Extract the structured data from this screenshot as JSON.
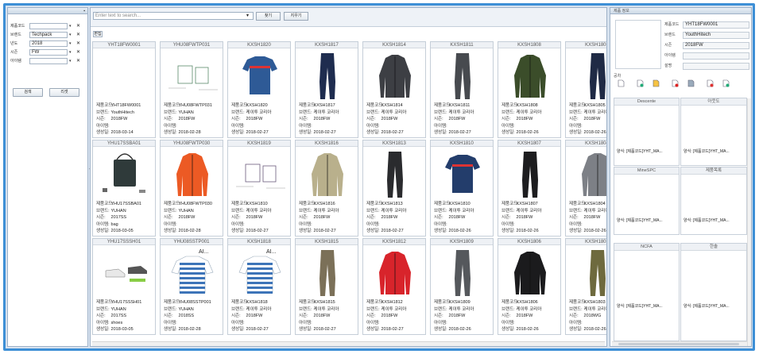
{
  "filters": [
    {
      "label": "제품코드",
      "value": ""
    },
    {
      "label": "브랜드",
      "value": "Techpack"
    },
    {
      "label": "년도",
      "value": "2018"
    },
    {
      "label": "시즌",
      "value": "FW"
    },
    {
      "label": "아이템",
      "value": ""
    }
  ],
  "left_buttons": {
    "search": "검색",
    "reset": "리셋"
  },
  "search": {
    "placeholder": "Enter text to search...",
    "find_label": "찾기",
    "clear_label": "지우기"
  },
  "grid_toggle_label": "편집",
  "labels": {
    "code": "제품코드:",
    "brand": "브랜드:",
    "season": "시즌:",
    "item": "아이템:",
    "created": "생성일:"
  },
  "cards": [
    {
      "code": "YHT18FW0001",
      "img": "blank",
      "color": "#fff",
      "v_code": "YHT18FW0001",
      "brand": "YouthHitech",
      "season": "2018FW",
      "item": "",
      "created": "2018-03-14"
    },
    {
      "code": "YHU08FWTP031",
      "img": "sketch",
      "color": "#5a8a6a",
      "v_code": "YHU08FWTP031",
      "brand": "YUHAN",
      "season": "2018FW",
      "item": "",
      "created": "2018-02-28"
    },
    {
      "code": "KXSH1820",
      "img": "shirt",
      "color": "#2e5a96",
      "v_code": "KXSH1820",
      "brand": "케이투 코리아",
      "season": "2018FW",
      "item": "",
      "created": "2018-02-27"
    },
    {
      "code": "KXSH1817",
      "img": "pants",
      "color": "#1e2c4f",
      "v_code": "KXSH1817",
      "brand": "케이투 코리아",
      "season": "2018FW",
      "item": "",
      "created": "2018-02-27"
    },
    {
      "code": "KXSH1814",
      "img": "jacket",
      "color": "#3d3f44",
      "v_code": "KXSH1814",
      "brand": "케이투 코리아",
      "season": "2018FW",
      "item": "",
      "created": "2018-02-27"
    },
    {
      "code": "KXSH1811",
      "img": "pants",
      "color": "#474a4f",
      "v_code": "KXSH1811",
      "brand": "케이투 코리아",
      "season": "2018FW",
      "item": "",
      "created": "2018-02-27"
    },
    {
      "code": "KXSH1808",
      "img": "jacket",
      "color": "#3b4d2a",
      "v_code": "KXSH1808",
      "brand": "케이투 코리아",
      "season": "2018FW",
      "item": "",
      "created": "2018-02-26"
    },
    {
      "code": "KXSH1805",
      "img": "pants",
      "color": "#1f2a45",
      "v_code": "KXSH1805",
      "brand": "케이투 코리아",
      "season": "2018FW",
      "item": "",
      "created": "2018-02-26"
    },
    {
      "code": "YHU17SSBA01",
      "img": "bag",
      "color": "#2f3a3a",
      "v_code": "YHU17SSBA01",
      "brand": "YUHAN",
      "season": "2017SS",
      "item": "bag",
      "created": "2018-03-05"
    },
    {
      "code": "YHU08FWTP030",
      "img": "jacket",
      "color": "#ec5a24",
      "v_code": "YHU08FWTP030",
      "brand": "YUHAN",
      "season": "2018FW",
      "item": "",
      "created": "2018-02-28"
    },
    {
      "code": "KXSH1819",
      "img": "sketch",
      "color": "#6a5a7a",
      "v_code": "KXSH1810",
      "brand": "케이투 코리아",
      "season": "2018FW",
      "item": "",
      "created": "2018-02-27"
    },
    {
      "code": "KXSH1816",
      "img": "jacket",
      "color": "#b9b08c",
      "v_code": "KXSH1816",
      "brand": "케이투 코리아",
      "season": "2018FW",
      "item": "",
      "created": "2018-02-27"
    },
    {
      "code": "KXSH1813",
      "img": "pants",
      "color": "#2a2b2e",
      "v_code": "KXSH1813",
      "brand": "케이투 코리아",
      "season": "2018FW",
      "item": "",
      "created": "2018-02-27"
    },
    {
      "code": "KXSH1810",
      "img": "shirt",
      "color": "#233d6b",
      "v_code": "KXSH1810",
      "brand": "케이투 코리아",
      "season": "2018FW",
      "item": "",
      "created": "2018-02-26"
    },
    {
      "code": "KXSH1807",
      "img": "pants",
      "color": "#1d1d1f",
      "v_code": "KXSH1807",
      "brand": "케이투 코리아",
      "season": "2018FW",
      "item": "",
      "created": "2018-02-26"
    },
    {
      "code": "KXSH1804",
      "img": "jacket",
      "color": "#7d8086",
      "v_code": "KXSH1804",
      "brand": "케이투 코리아",
      "season": "2018FW",
      "item": "",
      "created": "2018-02-26"
    },
    {
      "code": "YHU17SSSH01",
      "img": "shoes",
      "color": "#444",
      "v_code": "YHU17SSSH01",
      "brand": "YUHAN",
      "season": "2017SS",
      "item": "shoes",
      "created": "2018-03-05"
    },
    {
      "code": "YHU08SSTP001",
      "img": "stripe",
      "color": "#3d74b8",
      "v_code": "YHU08SSTP001",
      "brand": "YUHAN",
      "season": "2018SS",
      "item": "",
      "created": "2018-02-28"
    },
    {
      "code": "KXSH1818",
      "img": "stripe",
      "color": "#3d74b8",
      "v_code": "KXSH1818",
      "brand": "케이투 코리아",
      "season": "2018FW",
      "item": "",
      "created": "2018-02-27"
    },
    {
      "code": "KXSH1815",
      "img": "pants",
      "color": "#7b7058",
      "v_code": "KXSH1815",
      "brand": "케이투 코리아",
      "season": "2018FW",
      "item": "",
      "created": "2018-02-27"
    },
    {
      "code": "KXSH1812",
      "img": "jacket",
      "color": "#d8242b",
      "v_code": "KXSH1812",
      "brand": "케이투 코리아",
      "season": "2018FW",
      "item": "",
      "created": "2018-02-27"
    },
    {
      "code": "KXSH1809",
      "img": "pants",
      "color": "#55585c",
      "v_code": "KXSH1809",
      "brand": "케이투 코리아",
      "season": "2018FW",
      "item": "",
      "created": "2018-02-26"
    },
    {
      "code": "KXSH1806",
      "img": "jacket",
      "color": "#1b1b1d",
      "v_code": "KXSH1806",
      "brand": "케이투 코리아",
      "season": "2018FW",
      "item": "",
      "created": "2018-02-26"
    },
    {
      "code": "KXSH1803",
      "img": "pants",
      "color": "#6e6a3e",
      "v_code": "KXSH1803",
      "brand": "케이투 코리아",
      "season": "2018WG",
      "item": "",
      "created": "2018-02-26"
    }
  ],
  "ai_tag": "AI...",
  "detail": {
    "title": "제품 정보",
    "fields": [
      {
        "label": "제품코드",
        "value": "YHT18FW0001"
      },
      {
        "label": "브랜드",
        "value": "YouthHitech"
      },
      {
        "label": "시즌",
        "value": "2018FW"
      },
      {
        "label": "아이템",
        "value": ""
      },
      {
        "label": "설명",
        "value": ""
      }
    ],
    "spec_label": "공차",
    "toolbar_icons": [
      "new-file-icon",
      "open-file-icon",
      "save-file-icon",
      "delete-file-icon",
      "print-icon",
      "edit-icon",
      "export-icon"
    ],
    "panels": [
      {
        "header": "Descente",
        "footer": "양식: [제품코드]YHT_MA..."
      },
      {
        "header": "아웃도",
        "footer": "양식: [제품코드]YHT_MA..."
      },
      {
        "header": "MineSPC",
        "footer": "양식: [제품코드]YHT_MA..."
      },
      {
        "header": "제품목록",
        "footer": "양식: [제품코드]YHT_MA..."
      },
      {
        "header": "NCFA",
        "footer": "양식: [제품코드]YHT_MA..."
      },
      {
        "header": "한솔",
        "footer": "양식: [제품코드]YHT_MA..."
      }
    ]
  },
  "colors": {
    "frame": "#3d8fd6",
    "background": "#d7e2ef"
  }
}
